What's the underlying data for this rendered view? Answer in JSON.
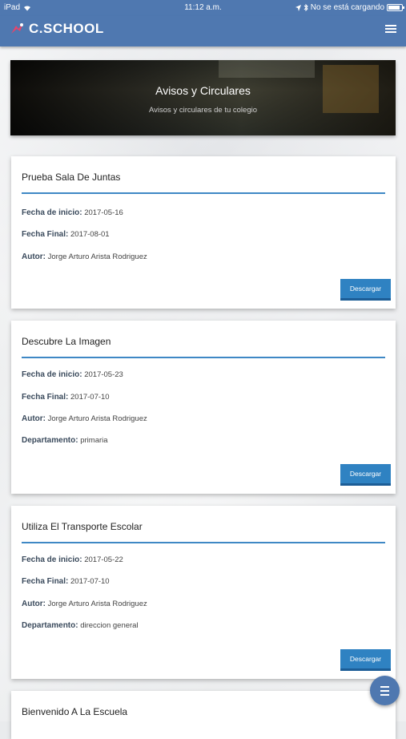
{
  "status_bar": {
    "device": "iPad",
    "time": "11:12 a.m.",
    "charging_text": "No se está cargando"
  },
  "navbar": {
    "brand": "C.SCHOOL"
  },
  "hero": {
    "title": "Avisos y Circulares",
    "subtitle": "Avisos y circulares de tu colegio"
  },
  "labels": {
    "start": "Fecha de inicio:",
    "end": "Fecha Final:",
    "author": "Autor:",
    "department": "Departamento:",
    "download": "Descargar"
  },
  "notices": [
    {
      "title": "Prueba Sala De Juntas",
      "start": "2017-05-16",
      "end": "2017-08-01",
      "author": "Jorge Arturo Arista Rodriguez"
    },
    {
      "title": "Descubre La Imagen",
      "start": "2017-05-23",
      "end": "2017-07-10",
      "author": "Jorge Arturo Arista Rodriguez",
      "department": "primaria"
    },
    {
      "title": "Utiliza El Transporte Escolar",
      "start": "2017-05-22",
      "end": "2017-07-10",
      "author": "Jorge Arturo Arista Rodriguez",
      "department": "direccion general"
    },
    {
      "title": "Bienvenido A La Escuela"
    }
  ],
  "colors": {
    "primary": "#4f78b0",
    "accent": "#3f88c5",
    "button": "#2f82c2"
  }
}
